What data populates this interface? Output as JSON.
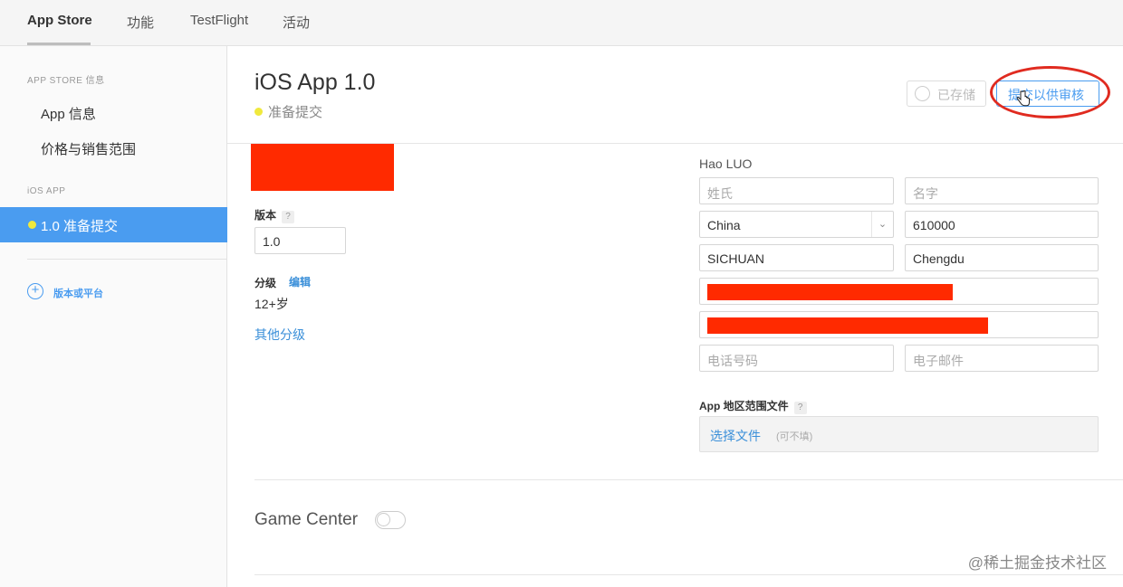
{
  "topnav": {
    "tabs": [
      "App Store",
      "功能",
      "TestFlight",
      "活动"
    ]
  },
  "sidebar": {
    "section1": "APP STORE 信息",
    "items": [
      "App 信息",
      "价格与销售范围"
    ],
    "section2": "iOS APP",
    "active_item": "1.0 准备提交",
    "add_label": "版本或平台"
  },
  "main": {
    "title": "iOS App 1.0",
    "status": "准备提交",
    "saved_button": "已存储",
    "submit_button": "提交以供审核",
    "version_label": "版本",
    "help_mark": "?",
    "version_value": "1.0",
    "rating_label": "分级",
    "rating_edit": "编辑",
    "rating_value": "12+岁",
    "other_ratings": "其他分级",
    "contact": {
      "name": "Hao LUO",
      "last_name_placeholder": "姓氏",
      "first_name_placeholder": "名字",
      "country": "China",
      "postal_code": "610000",
      "state": "SICHUAN",
      "city": "Chengdu",
      "phone_placeholder": "电话号码",
      "email_placeholder": "电子邮件"
    },
    "region_file_label": "App 地区范围文件",
    "choose_file": "选择文件",
    "optional": "(可不填)",
    "game_center": "Game Center"
  },
  "watermark": "@稀土掘金技术社区",
  "colors": {
    "accent": "#4a9cf0",
    "status_dot": "#f0e93d",
    "redaction": "#ff2a00",
    "annotation_ring": "#e02b20"
  }
}
